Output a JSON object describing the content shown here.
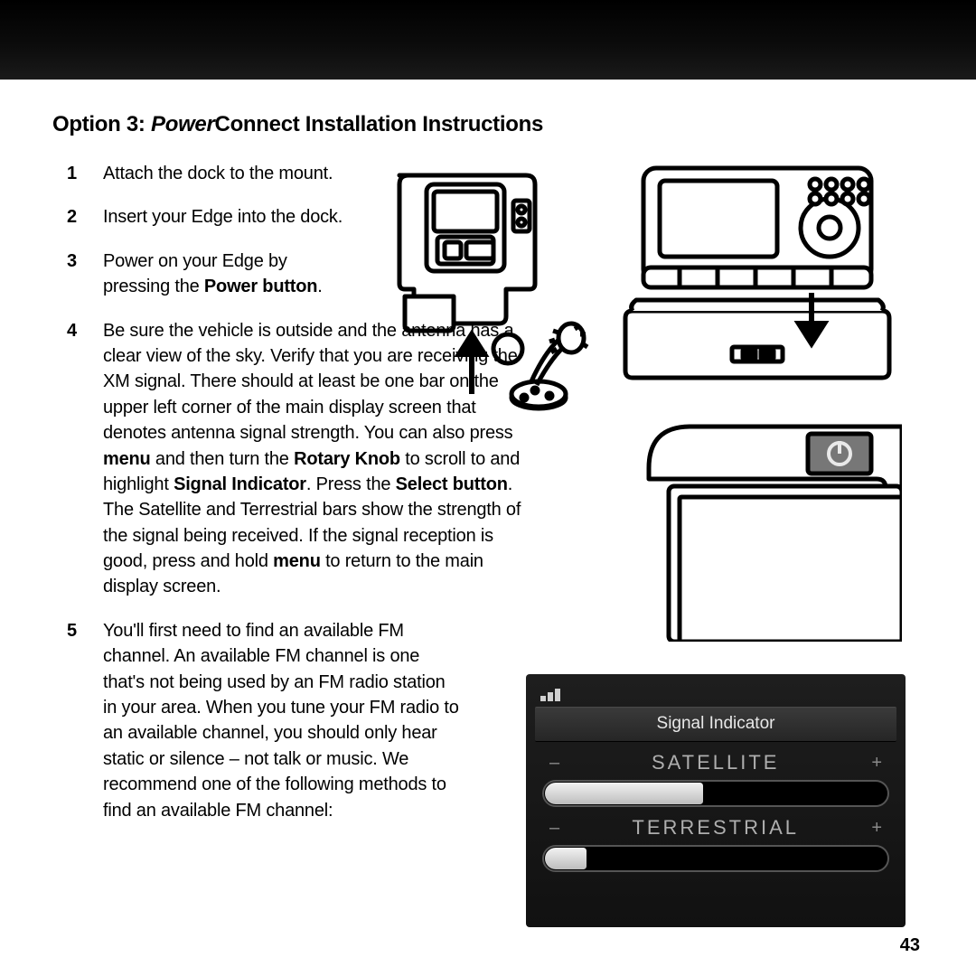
{
  "heading": {
    "prefix": "Option 3: ",
    "productItalic": "Power",
    "productRest": "Connect Installation Instructions"
  },
  "steps": {
    "s1": {
      "num": "1",
      "text": "Attach the dock to the mount."
    },
    "s2": {
      "num": "2",
      "text": "Insert your Edge into the dock."
    },
    "s3": {
      "num": "3",
      "before": "Power on your Edge by pressing the ",
      "bold1": "Power button",
      "after": "."
    },
    "s4": {
      "num": "4",
      "t1": "Be sure the vehicle is outside and the antenna has a clear view of the sky. Verify that you are receiving the XM signal. There should at least be one bar on the upper left corner of the main display screen that denotes antenna signal strength. You can also press ",
      "b1": "menu",
      "t2": " and then turn the ",
      "b2": "Rotary Knob",
      "t3": " to scroll to and highlight ",
      "b3": "Signal Indicator",
      "t4": ". Press the ",
      "b4": "Select button",
      "t5": ". The Satellite and Terrestrial bars show the strength of the signal being received. If the signal reception is good, press and hold ",
      "b5": "menu",
      "t6": " to return to the main display screen."
    },
    "s5": {
      "num": "5",
      "text": "You'll first need to find an available FM channel. An available FM channel is one that's not being used by an FM radio station in your area. When you tune your FM radio to an available channel, you should only hear static or silence – not talk or music. We recommend one of the following methods to find an available FM channel:"
    }
  },
  "signal": {
    "title": "Signal Indicator",
    "sat": {
      "label": "SATELLITE",
      "minus": "–",
      "plus": "+",
      "fillPercent": 46
    },
    "terr": {
      "label": "TERRESTRIAL",
      "minus": "–",
      "plus": "+",
      "fillPercent": 12
    }
  },
  "icons": {
    "dockMount": "dock-mount-illustration",
    "deviceDock": "device-in-dock-illustration",
    "powerCorner": "device-power-corner-illustration",
    "power": "power-icon",
    "signalBars": "signal-bars-icon"
  },
  "pageNumber": "43"
}
